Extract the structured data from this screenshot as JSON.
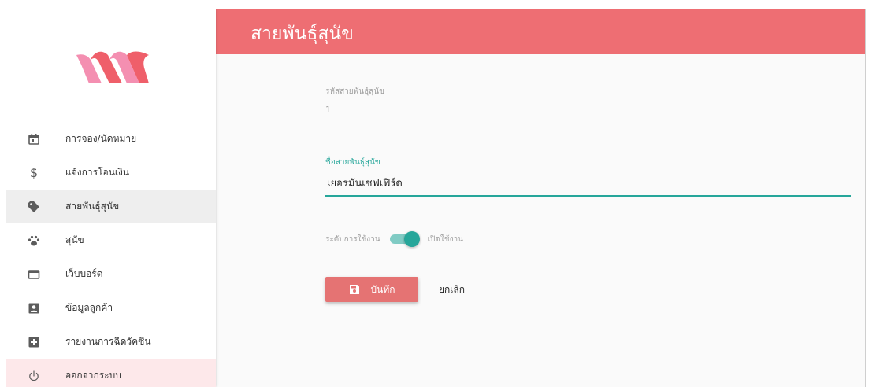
{
  "header": {
    "title": "สายพันธุ์สุนัข"
  },
  "sidebar": {
    "items": [
      {
        "label": "การจอง/นัดหมาย",
        "icon": "calendar-icon"
      },
      {
        "label": "แจ้งการโอนเงิน",
        "icon": "dollar-icon"
      },
      {
        "label": "สายพันธุ์สุนัข",
        "icon": "tag-icon",
        "active": true
      },
      {
        "label": "สุนัข",
        "icon": "paw-icon"
      },
      {
        "label": "เว็บบอร์ด",
        "icon": "webboard-icon"
      },
      {
        "label": "ข้อมูลลูกค้า",
        "icon": "contact-card-icon"
      },
      {
        "label": "รายงานการฉีดวัคซีน",
        "icon": "medical-plus-icon"
      },
      {
        "label": "ออกจากระบบ",
        "icon": "power-icon"
      }
    ]
  },
  "form": {
    "id_label": "รหัสสายพันธุ์สุนัข",
    "id_value": "1",
    "name_label": "ชื่อสายพันธุ์สุนัข",
    "name_value": "เยอรมันเชฟเฟิร์ด",
    "status_label": "ระดับการใช้งาน",
    "status_value": "เปิดใช้งาน",
    "status_on": true,
    "save_label": "บันทึก",
    "cancel_label": "ยกเลิก"
  },
  "colors": {
    "header": "#ee6e73",
    "accent": "#26a69a",
    "save_button": "#e57373",
    "logout_bg": "#fde8ea"
  }
}
